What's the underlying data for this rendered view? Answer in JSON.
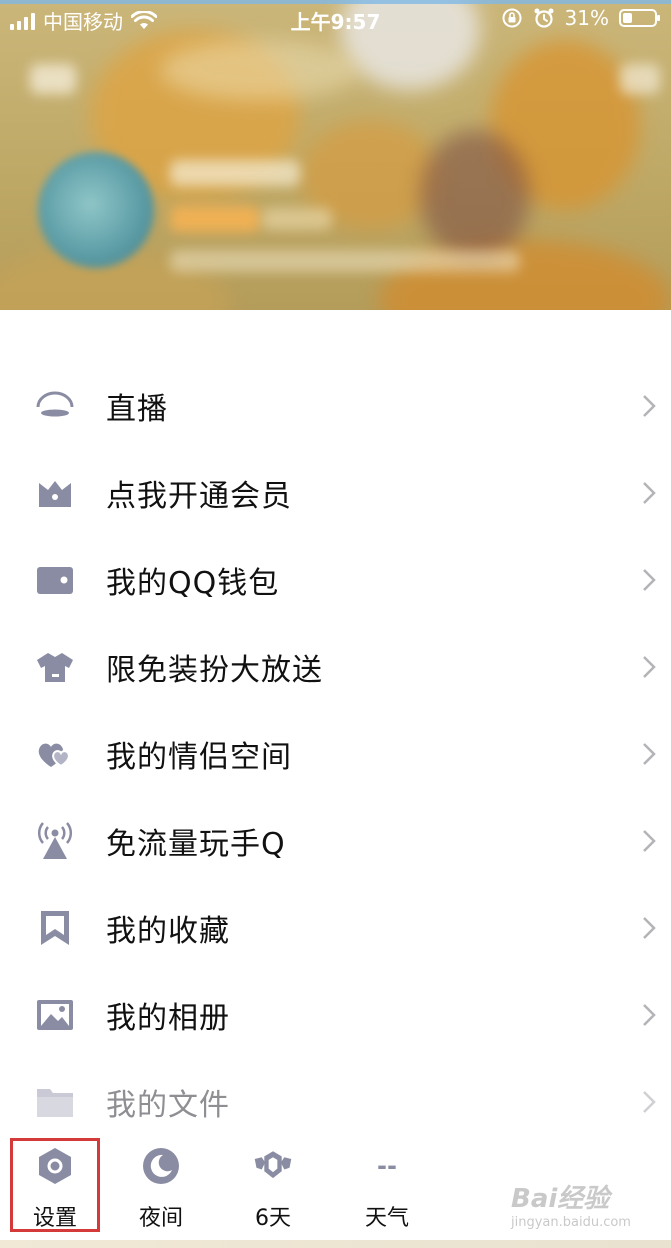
{
  "status_bar": {
    "carrier": "中国移动",
    "time": "上午9:57",
    "battery_percent": "31%"
  },
  "menu": {
    "items": [
      {
        "label": "直播",
        "icon": "live-icon"
      },
      {
        "label": "点我开通会员",
        "icon": "crown-icon"
      },
      {
        "label": "我的QQ钱包",
        "icon": "wallet-icon"
      },
      {
        "label": "限免装扮大放送",
        "icon": "shirt-icon"
      },
      {
        "label": "我的情侣空间",
        "icon": "hearts-icon"
      },
      {
        "label": "免流量玩手Q",
        "icon": "antenna-icon"
      },
      {
        "label": "我的收藏",
        "icon": "bookmark-icon"
      },
      {
        "label": "我的相册",
        "icon": "photo-icon"
      },
      {
        "label": "我的文件",
        "icon": "folder-icon"
      }
    ]
  },
  "toolbar": {
    "settings": "设置",
    "night": "夜间",
    "days": "6天",
    "weather": "天气",
    "weather_value": "--"
  },
  "watermark": {
    "brand": "Bai经验",
    "url": "jingyan.baidu.com"
  },
  "colors": {
    "icon": "#8a8ca3",
    "highlight": "#d43a3a"
  }
}
